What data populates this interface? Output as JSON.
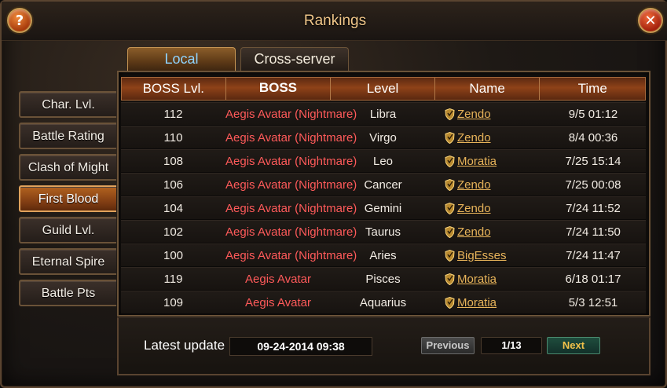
{
  "window": {
    "title": "Rankings"
  },
  "header": {
    "help_label": "?",
    "close_label": "✕"
  },
  "tabs": [
    {
      "label": "Local",
      "active": true
    },
    {
      "label": "Cross-server",
      "active": false
    }
  ],
  "sidebar": {
    "items": [
      {
        "label": "Char. Lvl.",
        "active": false
      },
      {
        "label": "Battle Rating",
        "active": false
      },
      {
        "label": "Clash of Might",
        "active": false
      },
      {
        "label": "First Blood",
        "active": true
      },
      {
        "label": "Guild Lvl.",
        "active": false
      },
      {
        "label": "Eternal Spire",
        "active": false
      },
      {
        "label": "Battle Pts",
        "active": false
      }
    ]
  },
  "table": {
    "columns": [
      "BOSS Lvl.",
      "BOSS",
      "Level",
      "Name",
      "Time"
    ],
    "rows": [
      {
        "boss_lvl": "112",
        "boss": "Aegis Avatar (Nightmare)",
        "level": "Libra",
        "name": "Zendo",
        "time": "9/5 01:12"
      },
      {
        "boss_lvl": "110",
        "boss": "Aegis Avatar (Nightmare)",
        "level": "Virgo",
        "name": "Zendo",
        "time": "8/4 00:36"
      },
      {
        "boss_lvl": "108",
        "boss": "Aegis Avatar (Nightmare)",
        "level": "Leo",
        "name": "Moratia",
        "time": "7/25 15:14"
      },
      {
        "boss_lvl": "106",
        "boss": "Aegis Avatar (Nightmare)",
        "level": "Cancer",
        "name": "Zendo",
        "time": "7/25 00:08"
      },
      {
        "boss_lvl": "104",
        "boss": "Aegis Avatar (Nightmare)",
        "level": "Gemini",
        "name": "Zendo",
        "time": "7/24 11:52"
      },
      {
        "boss_lvl": "102",
        "boss": "Aegis Avatar (Nightmare)",
        "level": "Taurus",
        "name": "Zendo",
        "time": "7/24 11:50"
      },
      {
        "boss_lvl": "100",
        "boss": "Aegis Avatar (Nightmare)",
        "level": "Aries",
        "name": "BigEsses",
        "time": "7/24 11:47"
      },
      {
        "boss_lvl": "119",
        "boss": "Aegis Avatar",
        "level": "Pisces",
        "name": "Moratia",
        "time": "6/18 01:17"
      },
      {
        "boss_lvl": "109",
        "boss": "Aegis Avatar",
        "level": "Aquarius",
        "name": "Moratia",
        "time": "5/3 12:51"
      }
    ]
  },
  "footer": {
    "update_label": "Latest update",
    "update_value": "09-24-2014 09:38",
    "prev_label": "Previous",
    "page_indicator": "1/13",
    "next_label": "Next"
  },
  "colors": {
    "boss_name": "#ff5a5a",
    "player_link": "#e8b45a",
    "active_tab_text": "#8fd4ff",
    "title": "#f1c78a"
  }
}
